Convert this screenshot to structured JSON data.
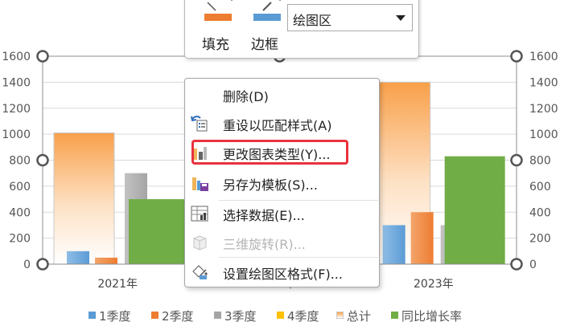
{
  "colors": {
    "q1": "#5b9bd5",
    "q2": "#ed7d31",
    "q3": "#a5a5a5",
    "q4": "#ffc000",
    "total_top": "#f9a04a",
    "growth": "#70ad47",
    "highlight": "#e8333f"
  },
  "chart_data": {
    "type": "bar",
    "categories": [
      "2021年",
      "2022年",
      "2023年"
    ],
    "ylim": [
      0,
      1600
    ],
    "yticks": [
      "0",
      "200",
      "400",
      "600",
      "800",
      "1000",
      "1200",
      "1400",
      "1600"
    ],
    "secondary_yticks": [
      "0",
      "200",
      "400",
      "600",
      "800",
      "1000",
      "1200",
      "1400",
      "1600"
    ],
    "grid": true,
    "legend_position": "bottom",
    "series": [
      {
        "name": "1季度",
        "values": [
          100,
          null,
          300
        ]
      },
      {
        "name": "2季度",
        "values": [
          50,
          null,
          400
        ]
      },
      {
        "name": "3季度",
        "values": [
          700,
          null,
          300
        ]
      },
      {
        "name": "4季度",
        "values": [
          null,
          null,
          null
        ]
      },
      {
        "name": "总计",
        "values": [
          1010,
          null,
          1400
        ]
      },
      {
        "name": "同比增长率",
        "values": [
          500,
          null,
          830
        ]
      }
    ]
  },
  "toolbar": {
    "fill_label": "填充",
    "border_label": "边框",
    "fill_icon": "paint-bucket-icon",
    "border_icon": "pen-icon",
    "select_value": "绘图区"
  },
  "context_menu": {
    "items": [
      {
        "label": "删除(D)",
        "icon": "delete-icon"
      },
      {
        "label": "重设以匹配样式(A)",
        "icon": "reset-style-icon"
      },
      {
        "label": "更改图表类型(Y)...",
        "icon": "change-chart-type-icon"
      },
      {
        "label": "另存为模板(S)...",
        "icon": "save-template-icon"
      },
      {
        "label": "选择数据(E)...",
        "icon": "select-data-icon"
      },
      {
        "label": "三维旋转(R)...",
        "icon": "rotate-3d-icon"
      },
      {
        "label": "设置绘图区格式(F)...",
        "icon": "format-plot-area-icon"
      }
    ]
  }
}
